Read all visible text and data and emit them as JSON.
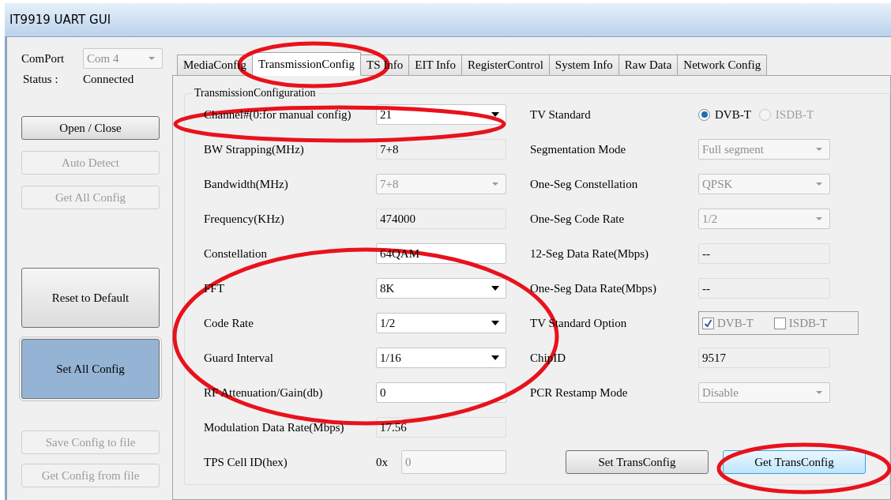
{
  "window": {
    "title": "IT9919 UART GUI"
  },
  "connection": {
    "comport_label": "ComPort",
    "comport": {
      "value": "Com 4",
      "disabled": true
    },
    "status_label": "Status :",
    "status": "Connected"
  },
  "side_buttons": [
    {
      "label": "Open / Close",
      "disabled": false,
      "focused": false,
      "tall": false
    },
    {
      "label": "Auto Detect",
      "disabled": true,
      "focused": false,
      "tall": false
    },
    {
      "label": "Get All Config",
      "disabled": true,
      "focused": false,
      "tall": false
    },
    {
      "label": "Reset to Default",
      "disabled": false,
      "focused": false,
      "tall": true
    },
    {
      "label": "Set All Config",
      "disabled": false,
      "focused": true,
      "tall": true
    },
    {
      "label": "Save Config to file",
      "disabled": true,
      "focused": false,
      "tall": false
    },
    {
      "label": "Get Config from file",
      "disabled": true,
      "focused": false,
      "tall": false
    }
  ],
  "tabs": [
    {
      "label": "MediaConfig",
      "selected": false
    },
    {
      "label": "TransmissionConfig",
      "selected": true
    },
    {
      "label": "TS Info",
      "selected": false
    },
    {
      "label": "EIT Info",
      "selected": false
    },
    {
      "label": "RegisterControl",
      "selected": false
    },
    {
      "label": "System Info",
      "selected": false
    },
    {
      "label": "Raw Data",
      "selected": false
    },
    {
      "label": "Network Config",
      "selected": false
    }
  ],
  "group": {
    "title": "TransmissionConfiguration",
    "left_rows": [
      {
        "label": "Channel#(0:for manual config)",
        "kind": "combo",
        "value": "21",
        "disabled": false,
        "readonly": false
      },
      {
        "label": "BW Strapping(MHz)",
        "kind": "text",
        "value": "7+8",
        "disabled": false,
        "readonly": true
      },
      {
        "label": "Bandwidth(MHz)",
        "kind": "combo",
        "value": "7+8",
        "disabled": true
      },
      {
        "label": "Frequency(KHz)",
        "kind": "text",
        "value": "474000",
        "disabled": false,
        "readonly": true
      },
      {
        "label": "Constellation",
        "kind": "text",
        "value": "64QAM",
        "disabled": false,
        "readonly": false
      },
      {
        "label": "FFT",
        "kind": "combo",
        "value": "8K",
        "disabled": false,
        "readonly": false
      },
      {
        "label": "Code Rate",
        "kind": "combo",
        "value": "1/2",
        "disabled": false,
        "readonly": false
      },
      {
        "label": "Guard Interval",
        "kind": "combo",
        "value": "1/16",
        "disabled": false,
        "readonly": false
      },
      {
        "label": "RF Attenuation/Gain(db)",
        "kind": "text",
        "value": "0",
        "disabled": false,
        "readonly": false
      },
      {
        "label": "Modulation Data Rate(Mbps)",
        "kind": "text",
        "value": "17.56",
        "disabled": false,
        "readonly": true
      },
      {
        "label": "TPS Cell ID(hex)",
        "kind": "hex",
        "prefix": "0x",
        "value": "0",
        "disabled": true
      }
    ],
    "right_rows": [
      {
        "label": "TV Standard",
        "kind": "radio",
        "options": [
          {
            "label": "DVB-T",
            "selected": true,
            "disabled": false
          },
          {
            "label": "ISDB-T",
            "selected": false,
            "disabled": true
          }
        ]
      },
      {
        "label": "Segmentation Mode",
        "kind": "combo",
        "value": "Full segment",
        "disabled": true
      },
      {
        "label": "One-Seg Constellation",
        "kind": "combo",
        "value": "QPSK",
        "disabled": true
      },
      {
        "label": "One-Seg Code Rate",
        "kind": "combo",
        "value": "1/2",
        "disabled": true
      },
      {
        "label": "12-Seg Data Rate(Mbps)",
        "kind": "text",
        "value": "--",
        "disabled": false,
        "readonly": true
      },
      {
        "label": "One-Seg Data Rate(Mbps)",
        "kind": "text",
        "value": "--",
        "disabled": false,
        "readonly": true
      },
      {
        "label": "TV Standard Option",
        "kind": "checks",
        "disabled": true,
        "options": [
          {
            "label": "DVB-T",
            "checked": true
          },
          {
            "label": "ISDB-T",
            "checked": false
          }
        ]
      },
      {
        "label": "ChipID",
        "kind": "text",
        "value": "9517",
        "disabled": false,
        "readonly": true
      },
      {
        "label": "PCR Restamp Mode",
        "kind": "combo",
        "value": "Disable",
        "disabled": true
      }
    ],
    "buttons": [
      {
        "label": "Set TransConfig",
        "focused": false
      },
      {
        "label": "Get TransConfig",
        "focused": true
      }
    ]
  }
}
